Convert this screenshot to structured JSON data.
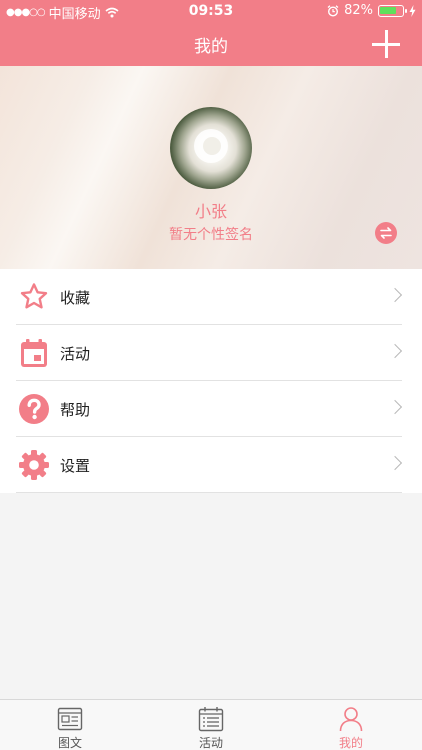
{
  "status_bar": {
    "signal": "●●●○○",
    "carrier": "中国移动",
    "time": "09:53",
    "battery_percent": "82%",
    "battery_level": 0.82
  },
  "nav": {
    "title": "我的",
    "add_icon": "plus-icon"
  },
  "profile": {
    "username": "小张",
    "signature": "暂无个性签名",
    "switch_icon": "swap-icon"
  },
  "menu": {
    "items": [
      {
        "label": "收藏",
        "icon": "star-icon"
      },
      {
        "label": "活动",
        "icon": "calendar-icon"
      },
      {
        "label": "帮助",
        "icon": "help-icon"
      },
      {
        "label": "设置",
        "icon": "gear-icon"
      }
    ]
  },
  "tabbar": {
    "tabs": [
      {
        "label": "图文",
        "icon": "article-icon",
        "active": false
      },
      {
        "label": "活动",
        "icon": "list-calendar-icon",
        "active": false
      },
      {
        "label": "我的",
        "icon": "person-icon",
        "active": true
      }
    ]
  },
  "colors": {
    "accent": "#f27e88",
    "battery": "#5fe05c"
  }
}
